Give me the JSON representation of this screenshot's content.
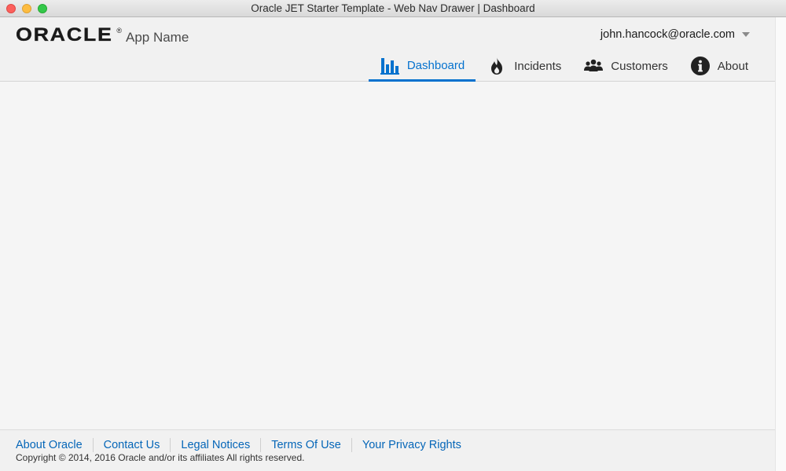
{
  "window": {
    "title": "Oracle JET Starter Template - Web Nav Drawer | Dashboard"
  },
  "header": {
    "logo_text": "ORACLE",
    "logo_mark": "®",
    "app_name": "App Name",
    "user": {
      "name": "john.hancock@oracle.com",
      "menu_icon": "caret-down-icon"
    }
  },
  "nav": {
    "items": [
      {
        "label": "Dashboard",
        "icon": "bar-chart-icon",
        "active": true
      },
      {
        "label": "Incidents",
        "icon": "fire-icon",
        "active": false
      },
      {
        "label": "Customers",
        "icon": "people-icon",
        "active": false
      },
      {
        "label": "About",
        "icon": "info-icon",
        "active": false
      }
    ]
  },
  "footer": {
    "links": [
      {
        "label": "About Oracle"
      },
      {
        "label": "Contact Us"
      },
      {
        "label": "Legal Notices"
      },
      {
        "label": "Terms Of Use"
      },
      {
        "label": "Your Privacy Rights"
      }
    ],
    "copyright": "Copyright © 2014, 2016 Oracle and/or its affiliates All rights reserved."
  },
  "colors": {
    "accent": "#0572ce",
    "link": "#0566b8",
    "text": "#333333",
    "header_bg": "#f1f1f1",
    "content_bg": "#f5f5f5"
  }
}
